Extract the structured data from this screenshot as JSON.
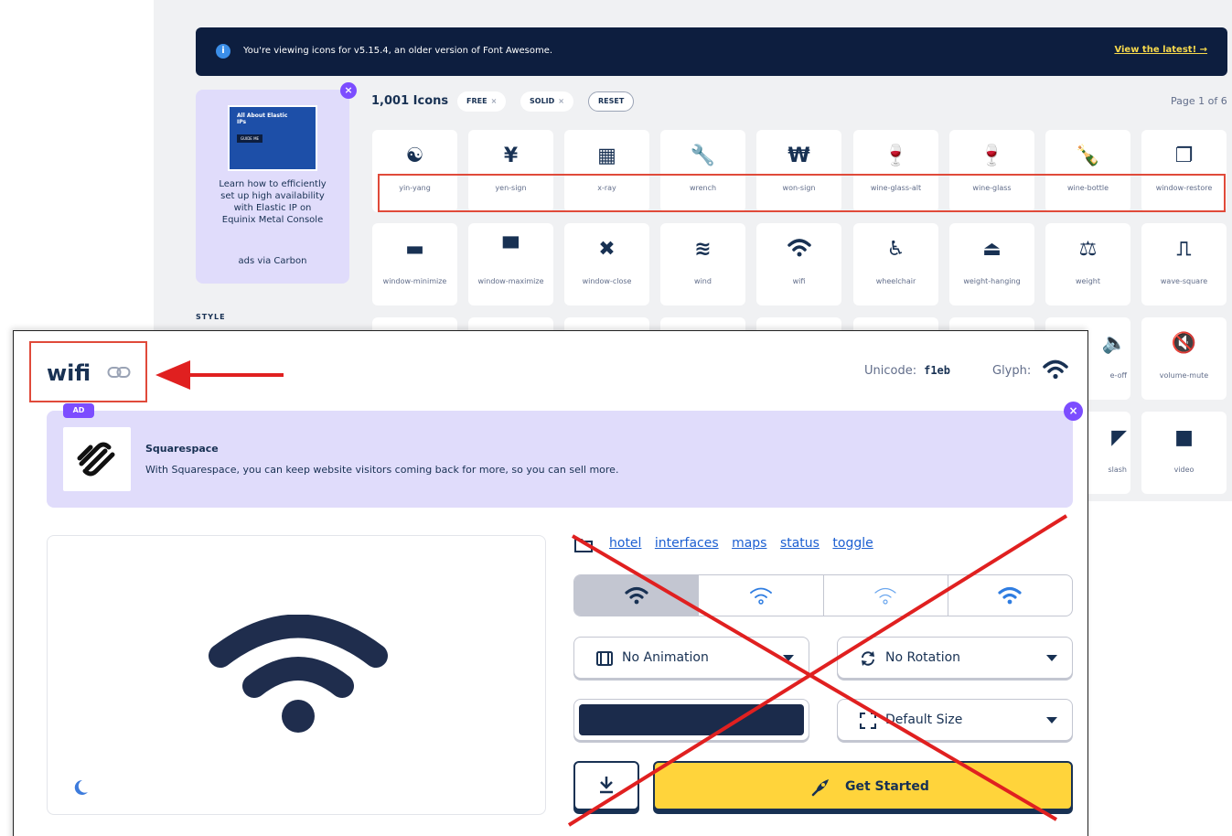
{
  "notice": {
    "text": "You're viewing icons for v5.15.4, an older version of Font Awesome.",
    "link": "View the latest!  →",
    "info_icon": "i"
  },
  "carbon": {
    "thumb_title": "All About Elastic IPs",
    "thumb_button": "GUIDE ME",
    "text": "Learn how to efficiently set up high availability with Elastic IP on Equinix Metal Console",
    "via": "ads via Carbon",
    "close": "×"
  },
  "results": {
    "count": "1,001 Icons",
    "chip_free": "FREE",
    "chip_solid": "SOLID",
    "chip_x": "×",
    "reset": "RESET",
    "page": "Page 1 of 6"
  },
  "style_section": "STYLE",
  "icons_row1": [
    {
      "name": "yin-yang",
      "glyph": "☯"
    },
    {
      "name": "yen-sign",
      "glyph": "¥"
    },
    {
      "name": "x-ray",
      "glyph": "▦"
    },
    {
      "name": "wrench",
      "glyph": "🔧"
    },
    {
      "name": "won-sign",
      "glyph": "₩"
    },
    {
      "name": "wine-glass-alt",
      "glyph": "🍷"
    },
    {
      "name": "wine-glass",
      "glyph": "🍷"
    },
    {
      "name": "wine-bottle",
      "glyph": "🍾"
    },
    {
      "name": "window-restore",
      "glyph": "❐"
    }
  ],
  "icons_row2": [
    {
      "name": "window-minimize",
      "glyph": "▬"
    },
    {
      "name": "window-maximize",
      "glyph": "▀"
    },
    {
      "name": "window-close",
      "glyph": "✖"
    },
    {
      "name": "wind",
      "glyph": "≋"
    },
    {
      "name": "wifi",
      "glyph": "📶"
    },
    {
      "name": "wheelchair",
      "glyph": "♿"
    },
    {
      "name": "weight-hanging",
      "glyph": "⏏"
    },
    {
      "name": "weight",
      "glyph": "⚖"
    },
    {
      "name": "wave-square",
      "glyph": "⎍"
    }
  ],
  "icons_row3_visible": [
    {
      "name": "volume-off",
      "label": "e-off",
      "glyph": "🔈"
    },
    {
      "name": "volume-mute",
      "label": "volume-mute",
      "glyph": "🔇"
    }
  ],
  "icons_row4_visible": [
    {
      "name": "video-slash",
      "label": "slash",
      "glyph": "◤"
    },
    {
      "name": "video",
      "label": "video",
      "glyph": "■"
    }
  ],
  "modal": {
    "title": "wifi",
    "unicode_label": "Unicode:",
    "unicode_value": "f1eb",
    "glyph_label": "Glyph:",
    "ad_badge": "AD",
    "ad_name": "Squarespace",
    "ad_copy": "With Squarespace, you can keep website visitors coming back for more, so you can sell more.",
    "ad_close": "×",
    "tags": [
      "hotel",
      "interfaces",
      "maps",
      "status",
      "toggle"
    ],
    "animation": "No Animation",
    "rotation": "No Rotation",
    "size": "Default Size",
    "swatch_color": "#1b2b4b",
    "cta": "Get Started",
    "download_icon": "download-icon"
  },
  "colors": {
    "accent": "#7c4dff",
    "brand_navy": "#183153",
    "cta_yellow": "#ffd43b",
    "annotation_red": "#e04a3a"
  }
}
